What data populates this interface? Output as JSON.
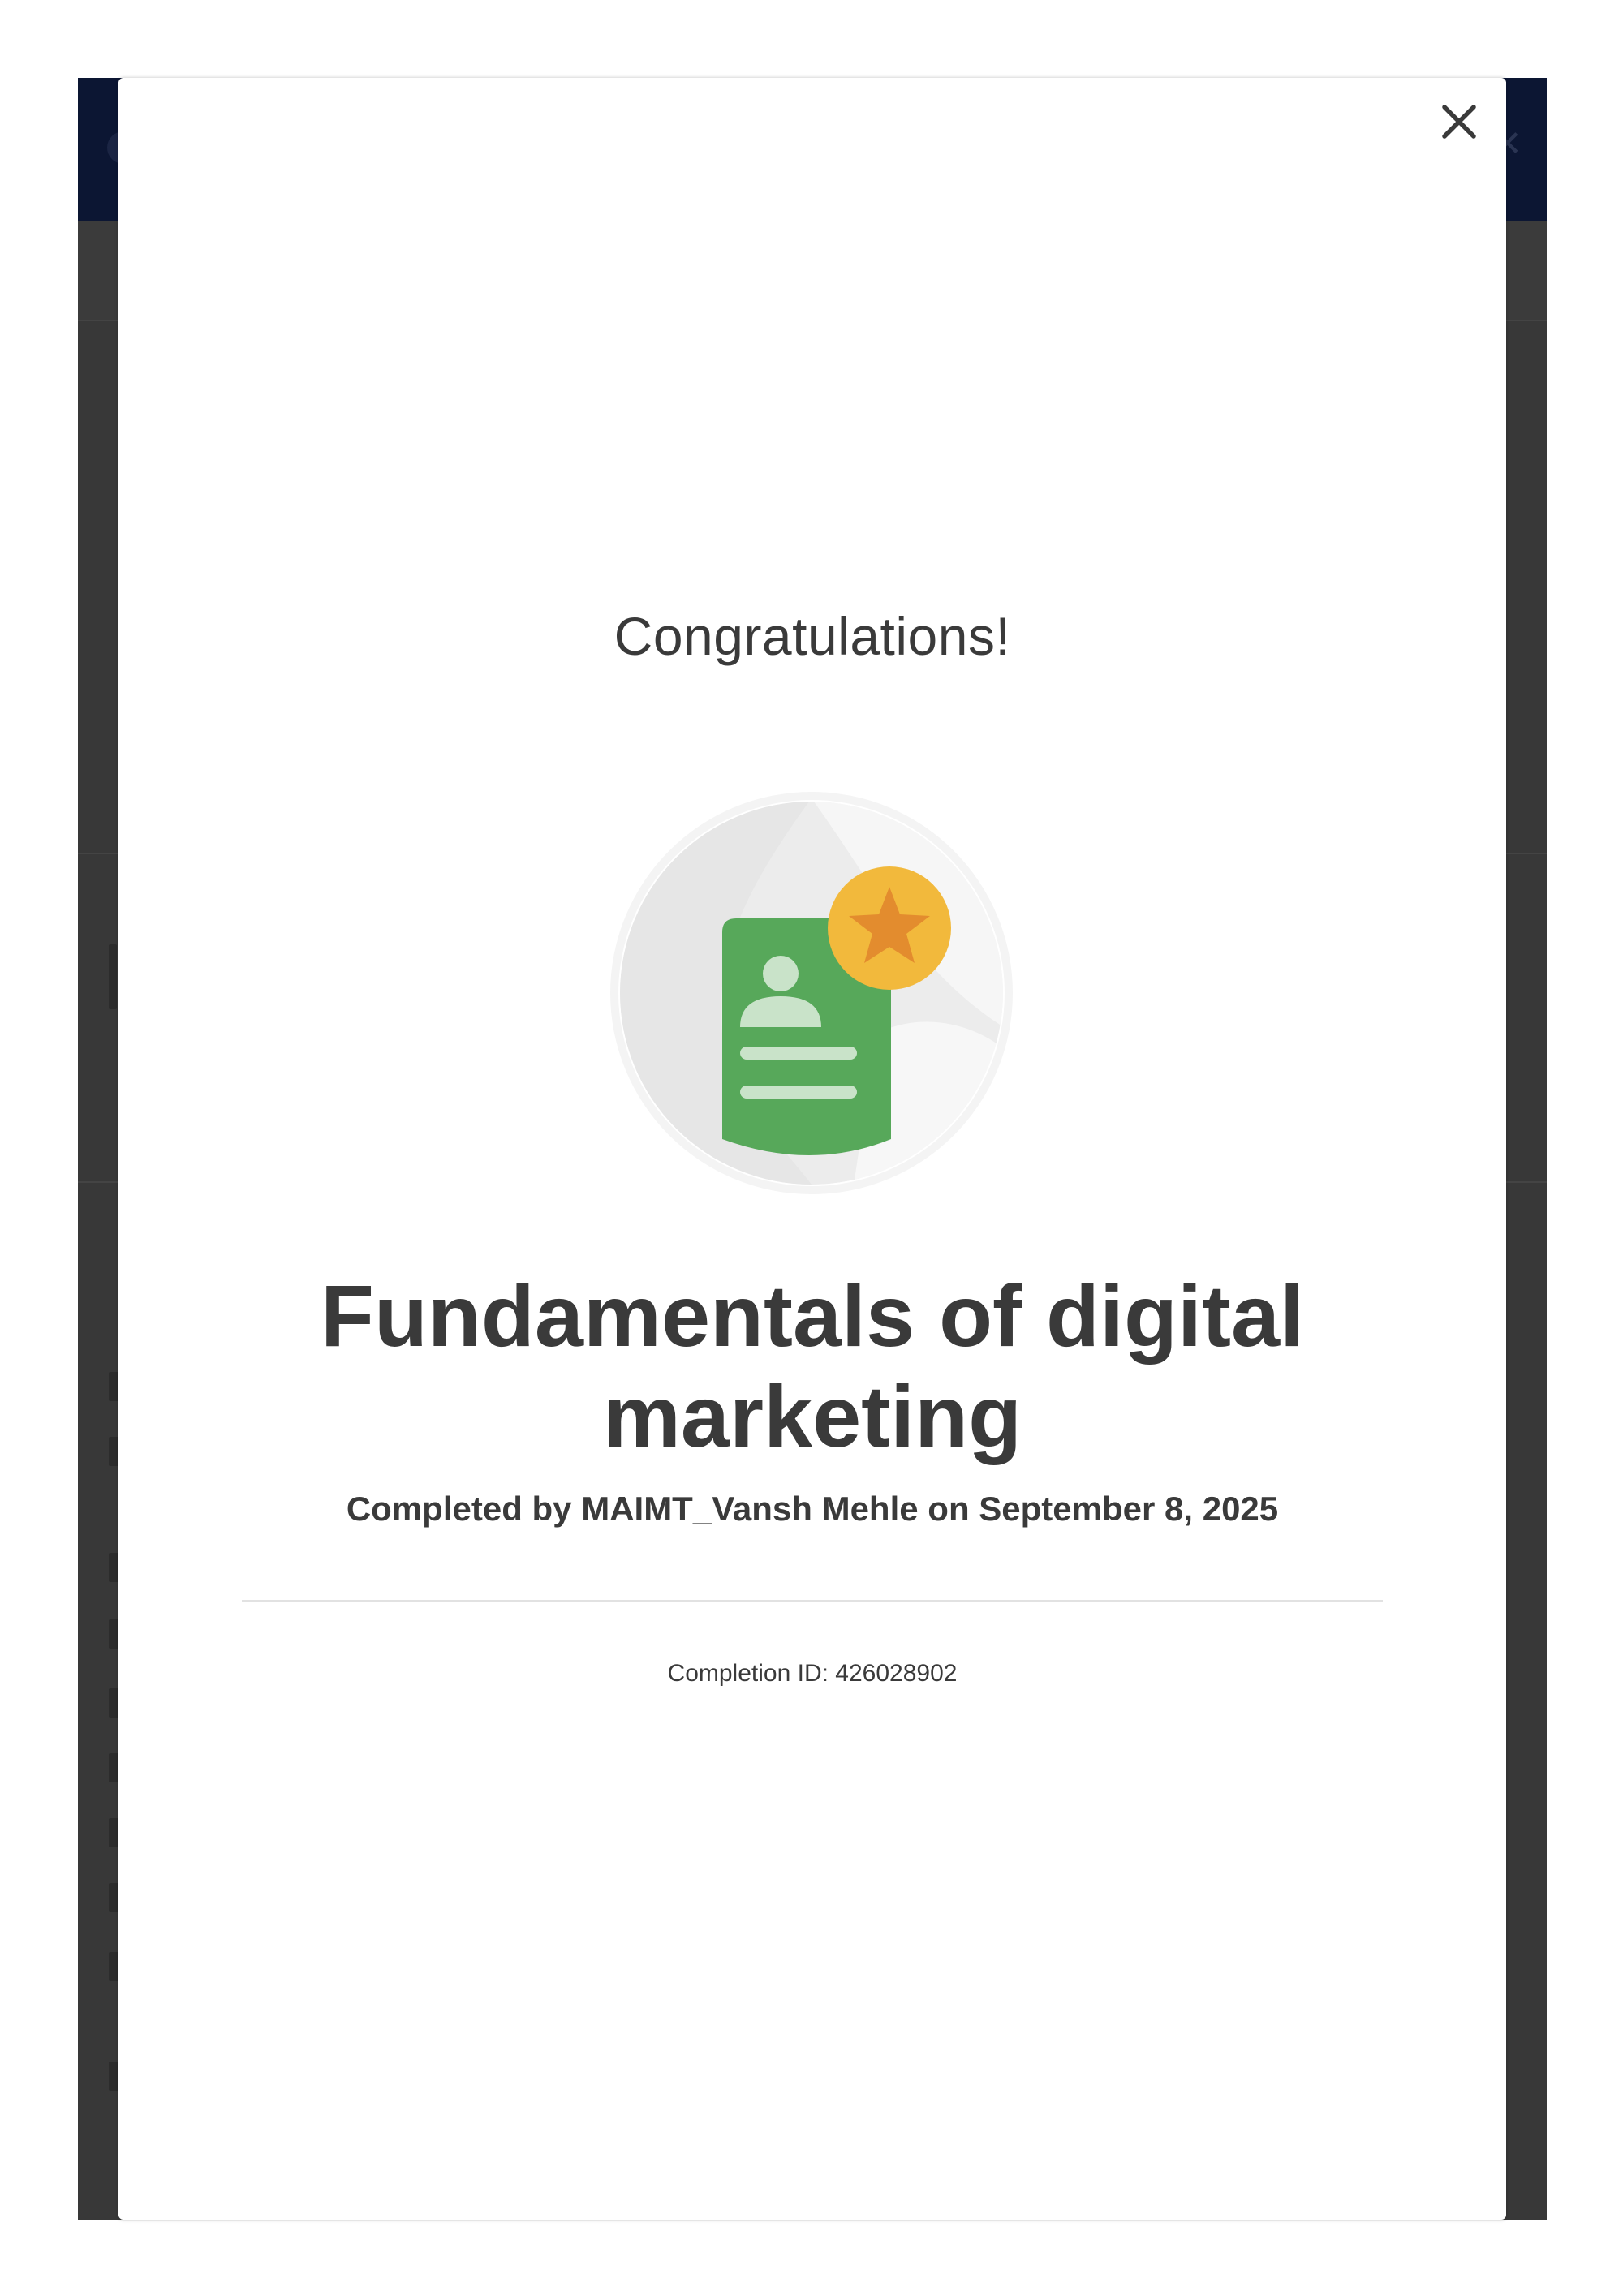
{
  "modal": {
    "heading": "Congratulations!",
    "badge_icon": "certificate-star-icon",
    "close_icon": "close-icon",
    "course_title": "Fundamentals of digital marketing",
    "completed_text": "Completed by MAIMT_Vansh Mehle on September 8, 2025",
    "completion_id": "Completion ID: 426028902"
  },
  "colors": {
    "header_navy": "#0c1633",
    "overlay_dim": "#383838",
    "badge_green": "#57a85a",
    "badge_gold": "#f2b93c",
    "badge_star": "#e38c2e",
    "text_dark": "#3a3a3a"
  }
}
